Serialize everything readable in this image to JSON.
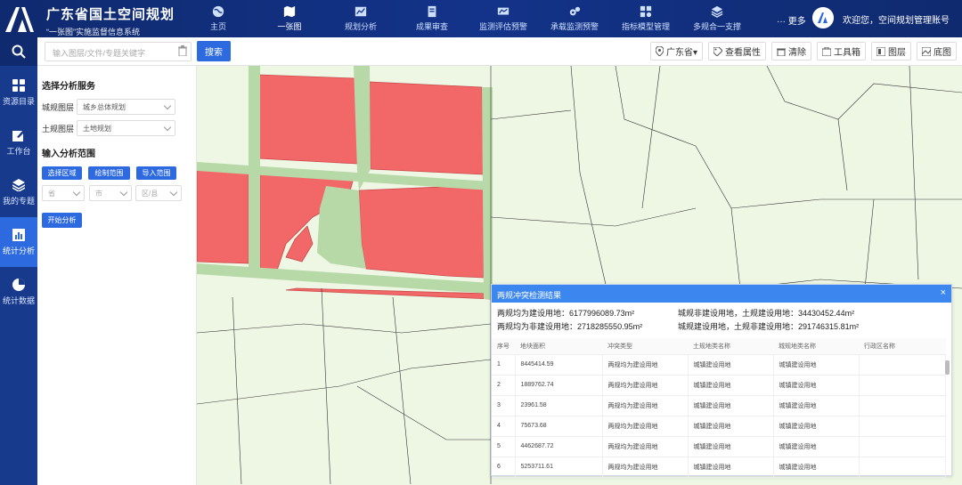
{
  "header": {
    "title": "广东省国土空间规划",
    "subtitle": "“一张图”实施监督信息系统",
    "nav": [
      {
        "label": "主页",
        "icon": "globe-icon"
      },
      {
        "label": "一张图",
        "icon": "map-icon"
      },
      {
        "label": "规划分析",
        "icon": "analysis-icon"
      },
      {
        "label": "成果审查",
        "icon": "review-icon"
      },
      {
        "label": "监测评估预警",
        "icon": "monitor-icon"
      },
      {
        "label": "承载监测预警",
        "icon": "gears-icon"
      },
      {
        "label": "指标模型管理",
        "icon": "model-icon"
      },
      {
        "label": "多规合一支撑",
        "icon": "layers-icon"
      }
    ],
    "more": "··· 更多",
    "welcome": "欢迎您，空间规划管理账号"
  },
  "sidebar": {
    "items": [
      {
        "label": "资源目录",
        "icon": "grid-icon"
      },
      {
        "label": "工作台",
        "icon": "edit-icon"
      },
      {
        "label": "我的专题",
        "icon": "stack-icon"
      },
      {
        "label": "统计分析",
        "icon": "bar-chart-icon"
      },
      {
        "label": "统计数据",
        "icon": "pie-chart-icon"
      }
    ]
  },
  "toolbar": {
    "search_placeholder": "输入图层/文件/专题关键字",
    "search_label": "搜索",
    "region": "广东省▾",
    "tools": [
      "查看属性",
      "清除",
      "工具箱",
      "图层",
      "底图"
    ]
  },
  "panel": {
    "section1": "选择分析服务",
    "city_layer_label": "城规图层",
    "city_layer_value": "城乡总体规划",
    "land_layer_label": "土规图层",
    "land_layer_value": "土地规划",
    "section2": "输入分析范围",
    "btn_select": "选择区域",
    "btn_draw": "绘制范围",
    "btn_import": "导入范围",
    "province": "省",
    "city": "市",
    "district": "区/县",
    "start": "开始分析"
  },
  "result": {
    "title": "两规冲突检测结果",
    "stat1_label": "两规均为建设用地：",
    "stat1_value": "6177996089.73m²",
    "stat2_label": "城规非建设用地，土规建设用地：",
    "stat2_value": "34430452.44m²",
    "stat3_label": "两规均为非建设用地：",
    "stat3_value": "2718285550.95m²",
    "stat4_label": "城规建设用地，土规非建设用地：",
    "stat4_value": "291746315.81m²",
    "columns": [
      "序号",
      "地块面积",
      "冲突类型",
      "土规地类名称",
      "城规地类名称",
      "行政区名称"
    ],
    "rows": [
      [
        "1",
        "8445414.59",
        "两规均为建设用地",
        "城镇建设用地",
        "城镇建设用地",
        ""
      ],
      [
        "2",
        "1889762.74",
        "两规均为建设用地",
        "城镇建设用地",
        "城镇建设用地",
        ""
      ],
      [
        "3",
        "23961.58",
        "两规均为建设用地",
        "城镇建设用地",
        "城镇建设用地",
        ""
      ],
      [
        "4",
        "75673.68",
        "两规均为建设用地",
        "城镇建设用地",
        "城镇建设用地",
        ""
      ],
      [
        "5",
        "4462687.72",
        "两规均为建设用地",
        "城镇建设用地",
        "城镇建设用地",
        ""
      ],
      [
        "6",
        "5253711.61",
        "两规均为建设用地",
        "城镇建设用地",
        "城镇建设用地",
        ""
      ]
    ]
  }
}
